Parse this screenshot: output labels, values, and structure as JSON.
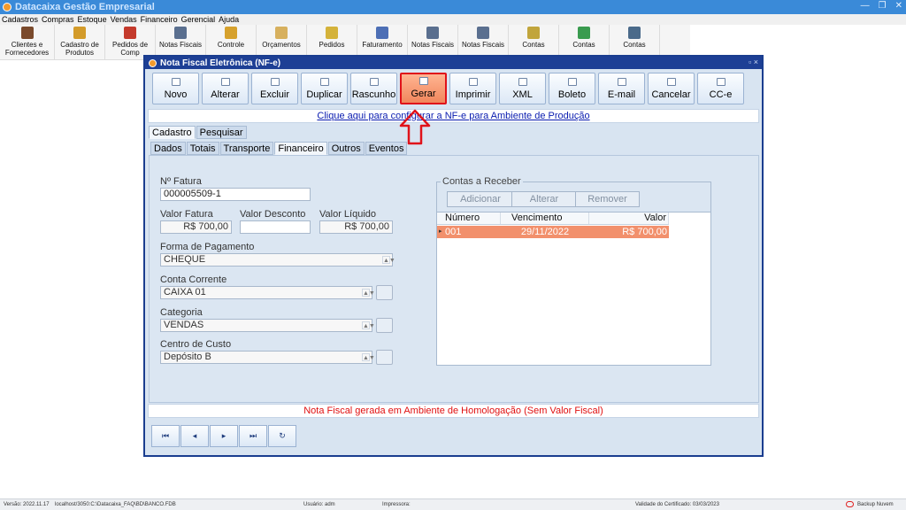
{
  "app": {
    "title": "Datacaixa Gestão Empresarial"
  },
  "menu": [
    "Cadastros",
    "Compras",
    "Estoque",
    "Vendas",
    "Financeiro",
    "Gerencial",
    "Ajuda"
  ],
  "ribbon": [
    {
      "label": "Clientes e Fornecedores",
      "icon": "people-icon",
      "color": "#7a4a2c"
    },
    {
      "label": "Cadastro de Produtos",
      "icon": "box-icon",
      "color": "#d39b2a"
    },
    {
      "label": "Pedidos de Comp",
      "icon": "order-icon",
      "color": "#c43a2c"
    },
    {
      "label": "Notas Fiscais",
      "icon": "invoice-icon",
      "color": "#5a6f8f"
    },
    {
      "label": "Controle",
      "icon": "control-icon",
      "color": "#d6a12d"
    },
    {
      "label": "Orçamentos",
      "icon": "quote-icon",
      "color": "#d7b05e"
    },
    {
      "label": "Pedidos",
      "icon": "pedido-icon",
      "color": "#d4b23a"
    },
    {
      "label": "Faturamento",
      "icon": "billing-icon",
      "color": "#4d6fb5"
    },
    {
      "label": "Notas Fiscais",
      "icon": "invoice2-icon",
      "color": "#5a6f8f"
    },
    {
      "label": "Notas Fiscais",
      "icon": "invoice3-icon",
      "color": "#5a6f8f"
    },
    {
      "label": "Contas",
      "icon": "money-icon",
      "color": "#c1a53c"
    },
    {
      "label": "Contas",
      "icon": "money2-icon",
      "color": "#3a9b4f"
    },
    {
      "label": "Contas",
      "icon": "wallet-icon",
      "color": "#4a6a8a"
    }
  ],
  "dialog": {
    "title": "Nota Fiscal Eletrônica (NF-e)",
    "controls": "▫ ×",
    "toolbar": [
      {
        "label": "Novo",
        "active": false
      },
      {
        "label": "Alterar",
        "active": false
      },
      {
        "label": "Excluir",
        "active": false
      },
      {
        "label": "Duplicar",
        "active": false
      },
      {
        "label": "Rascunho",
        "active": false
      },
      {
        "label": "Gerar",
        "active": true
      },
      {
        "label": "Imprimir",
        "active": false
      },
      {
        "label": "XML",
        "active": false
      },
      {
        "label": "Boleto",
        "active": false
      },
      {
        "label": "E-mail",
        "active": false
      },
      {
        "label": "Cancelar",
        "active": false
      },
      {
        "label": "CC-e",
        "active": false
      }
    ],
    "production_link": "Clique aqui para configurar a NF-e para Ambiente de Produção",
    "main_tabs": [
      {
        "label": "Cadastro",
        "selected": true
      },
      {
        "label": "Pesquisar",
        "selected": false
      }
    ],
    "sub_tabs": [
      {
        "label": "Dados",
        "selected": false
      },
      {
        "label": "Totais",
        "selected": false
      },
      {
        "label": "Transporte",
        "selected": false
      },
      {
        "label": "Financeiro",
        "selected": true
      },
      {
        "label": "Outros",
        "selected": false
      },
      {
        "label": "Eventos",
        "selected": false
      }
    ],
    "form": {
      "fatura_label": "Nº Fatura",
      "fatura_value": "000005509-1",
      "valor_fatura_label": "Valor Fatura",
      "valor_fatura_value": "R$ 700,00",
      "valor_desconto_label": "Valor Desconto",
      "valor_desconto_value": "",
      "valor_liquido_label": "Valor Líquido",
      "valor_liquido_value": "R$ 700,00",
      "forma_pagamento_label": "Forma de Pagamento",
      "forma_pagamento_value": "CHEQUE",
      "conta_corrente_label": "Conta Corrente",
      "conta_corrente_value": "CAIXA 01",
      "categoria_label": "Categoria",
      "categoria_value": "VENDAS",
      "centro_custo_label": "Centro de Custo",
      "centro_custo_value": "Depósito B"
    },
    "contas_receber": {
      "title": "Contas a Receber",
      "buttons": [
        "Adicionar",
        "Alterar",
        "Remover"
      ],
      "columns": [
        "Número",
        "Vencimento",
        "Valor"
      ],
      "rows": [
        {
          "numero": "001",
          "vencimento": "29/11/2022",
          "valor": "R$ 700,00"
        }
      ]
    },
    "status_message": "Nota Fiscal gerada em Ambiente de Homologação (Sem Valor Fiscal)",
    "nav_buttons": [
      "first-icon",
      "prev-icon",
      "next-icon",
      "last-icon",
      "refresh-icon"
    ]
  },
  "statusbar": {
    "version": "Versão: 2022.11.17",
    "db": "localhost/3050:C:\\Datacaixa_FAQ\\BD\\BANCO.FDB",
    "user": "Usuário: adm",
    "printer": "Impressora:",
    "cert": "Validade do Certificado: 03/03/2023",
    "backup": "Backup Nuvem"
  },
  "colors": {
    "titlebar": "#3a8ad8",
    "dialog_title": "#1d3f95",
    "highlight_row": "#f2906c",
    "gerar_border": "#e0121a",
    "status_text": "#e01010"
  }
}
